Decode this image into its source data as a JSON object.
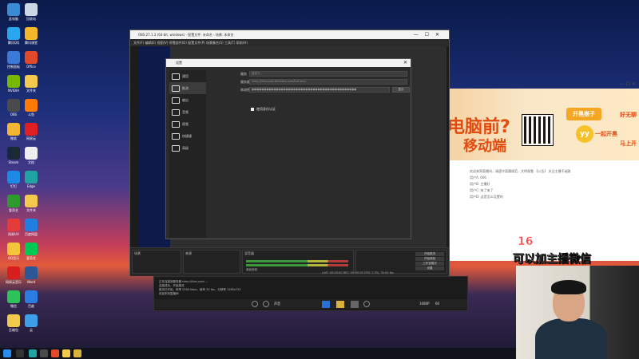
{
  "desktop": {
    "icons": [
      {
        "label": "此电脑",
        "color": "#3a8ad6"
      },
      {
        "label": "回收站",
        "color": "#ccd7e6"
      },
      {
        "label": "腾讯QQ",
        "color": "#29a6f0"
      },
      {
        "label": "腾讯课堂",
        "color": "#f5b72a"
      },
      {
        "label": "控制面板",
        "color": "#3b79d8"
      },
      {
        "label": "Office",
        "color": "#e04a2a"
      },
      {
        "label": "NVIDIA",
        "color": "#76b900"
      },
      {
        "label": "文件夹",
        "color": "#f2c94c"
      },
      {
        "label": "OBS",
        "color": "#4a4a4a"
      },
      {
        "label": "斗鱼",
        "color": "#ff7a00"
      },
      {
        "label": "微软",
        "color": "#f2b632"
      },
      {
        "label": "网易云",
        "color": "#e02020"
      },
      {
        "label": "Steam",
        "color": "#1b2838"
      },
      {
        "label": "文档",
        "color": "#eeeeee"
      },
      {
        "label": "钉钉",
        "color": "#1e88e5"
      },
      {
        "label": "Edge",
        "color": "#1fa3a3"
      },
      {
        "label": "爱奇艺",
        "color": "#2c9a2c"
      },
      {
        "label": "文件夹",
        "color": "#f2c94c"
      },
      {
        "label": "网易UU",
        "color": "#e43b3b"
      },
      {
        "label": "百度网盘",
        "color": "#1f7fe0"
      },
      {
        "label": "QQ音乐",
        "color": "#f4c43a"
      },
      {
        "label": "爱奇艺",
        "color": "#00c853"
      },
      {
        "label": "网易云音乐",
        "color": "#d81e1e"
      },
      {
        "label": "Word",
        "color": "#2b5797"
      },
      {
        "label": "微信",
        "color": "#2ec35a"
      },
      {
        "label": "百度",
        "color": "#2a7de1"
      },
      {
        "label": "压缩包",
        "color": "#f2c94c"
      },
      {
        "label": "云",
        "color": "#3ba0e8"
      }
    ]
  },
  "obs": {
    "title": "OBS 27.1.3 (64-bit, windows) - 配置文件: 未命名 - 场景: 未命名",
    "menu": "文件(F)  编辑(E)  视图(V)  停靠部件(D)  配置文件(P)  场景集合(S)  工具(T)  帮助(H)",
    "scenes_header": "场景",
    "sources_header": "来源",
    "mixer_header": "混音器",
    "mixer_label": "桌面音频",
    "btn_start_stream": "开始推流",
    "btn_start_record": "开始录制",
    "btn_studio": "工作室模式",
    "btn_settings": "设置",
    "btn_exit": "退出",
    "status": "LIVE: 00:00:00  REC: 00:00:00  CPU: 2.3%, 30.00 fps"
  },
  "settings": {
    "title": "设置",
    "nav": [
      {
        "label": "通用",
        "icon": "gear-icon"
      },
      {
        "label": "推流",
        "icon": "stream-icon"
      },
      {
        "label": "输出",
        "icon": "output-icon"
      },
      {
        "label": "音频",
        "icon": "audio-icon"
      },
      {
        "label": "视频",
        "icon": "monitor-icon"
      },
      {
        "label": "快捷键",
        "icon": "keyboard-icon"
      },
      {
        "label": "高级",
        "icon": "tools-icon"
      }
    ],
    "service_label": "服务",
    "service_value": "自定义...",
    "server_label": "服务器",
    "server_value": "rtmp://live-push.bilivideo.com/live-bvc/",
    "key_label": "串流密钥",
    "key_value": "●●●●●●●●●●●●●●●●●●●●●●●●●●●●●●●●●●●●●●●●●●●",
    "show_button": "显示",
    "use_auth_label": "使用身份认证"
  },
  "control_window": {
    "log_lines": [
      "正在连接到服务器 rtmp://live-push ...",
      "连接成功，开始推流",
      "推流已开始，码率 2500 kbps，帧率 30 fps，分辨率 1280x720",
      "欢迎来到直播间"
    ],
    "quality": "1080P",
    "fps": "60",
    "volume_label": "声音"
  },
  "live_app": {
    "banner_title": "电脑前?",
    "banner_sub": "移动端",
    "yy_pill": "开黑搭子",
    "yy_logo": "yy",
    "yy_text": "一起开黑",
    "yy_side": "好无聊",
    "yy_side2": "马上开",
    "chat_lines": [
      "欢迎来到直播间，请遵守直播规范，文明观看 【公告】 关注主播不迷路",
      "用户A: 666",
      "用户B: 主播好",
      "用户C: 来了来了",
      "用户D: 这是怎么设置的"
    ],
    "level_text": "16级",
    "add_text": "可以加主播微信"
  }
}
